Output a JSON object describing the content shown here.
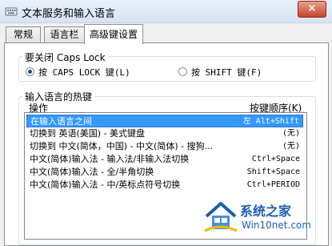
{
  "window": {
    "title": "文本服务和输入语言",
    "close_glyph": "×"
  },
  "tabs": [
    {
      "label": "常规",
      "active": false
    },
    {
      "label": "语言栏",
      "active": false
    },
    {
      "label": "高级键设置",
      "active": true
    }
  ],
  "caps_lock": {
    "group_title": "要关闭 Caps Lock",
    "options": [
      {
        "label": "按 CAPS LOCK 键(L)",
        "checked": true
      },
      {
        "label": "按 SHIFT 键(F)",
        "checked": false
      }
    ]
  },
  "hotkeys": {
    "group_title": "输入语言的热键",
    "col_action": "操作",
    "col_keys": "按键顺序(K)",
    "rows": [
      {
        "action": "在输入语言之间",
        "keys": "左 Alt+Shift",
        "selected": true
      },
      {
        "action": "切换到 英语(美国) - 美式键盘",
        "keys": "(无)",
        "selected": false
      },
      {
        "action": "切换到 中文(简体，中国) - 中文(简体) - 搜狗...",
        "keys": "(无)",
        "selected": false
      },
      {
        "action": "中文(简体)输入法 - 输入法/非输入法切换",
        "keys": "Ctrl+Space",
        "selected": false
      },
      {
        "action": "中文(简体)输入法 - 全/半角切换",
        "keys": "Shift+Space",
        "selected": false
      },
      {
        "action": "中文(简体)输入法 - 中/英标点符号切换",
        "keys": "Ctrl+PERIOD",
        "selected": false
      }
    ]
  },
  "watermark": {
    "text": "系统之家",
    "sub": "Win10net.com"
  },
  "icons": {
    "app": "keyboard-icon",
    "watermark": "house-logo-icon"
  },
  "colors": {
    "selection": "#3399ff",
    "accent": "#1a5fb0"
  }
}
